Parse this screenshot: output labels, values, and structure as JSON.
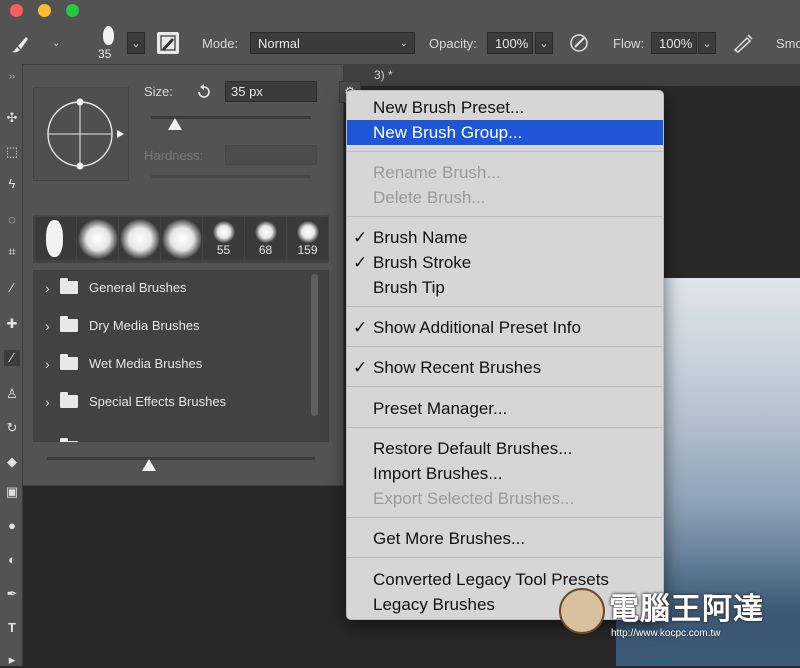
{
  "toolbar": {
    "brush_size": "35",
    "mode_label": "Mode:",
    "mode_value": "Normal",
    "opacity_label": "Opacity:",
    "opacity_value": "100%",
    "flow_label": "Flow:",
    "flow_value": "100%",
    "smoothing_label": "Smo"
  },
  "brush_panel": {
    "size_label": "Size:",
    "size_value": "35 px",
    "hardness_label": "Hardness:",
    "recent_tips": [
      {
        "label": ""
      },
      {
        "label": ""
      },
      {
        "label": ""
      },
      {
        "label": ""
      },
      {
        "label": "55"
      },
      {
        "label": "68"
      },
      {
        "label": "159"
      }
    ],
    "folders": [
      {
        "label": "General Brushes"
      },
      {
        "label": "Dry Media Brushes"
      },
      {
        "label": "Wet Media Brushes"
      },
      {
        "label": "Special Effects Brushes"
      }
    ]
  },
  "document": {
    "tab_fragment": "3) *"
  },
  "menu": {
    "items": [
      {
        "label": "New Brush Preset...",
        "checked": false,
        "disabled": false,
        "highlighted": false
      },
      {
        "label": "New Brush Group...",
        "checked": false,
        "disabled": false,
        "highlighted": true
      },
      {
        "label": "Rename Brush...",
        "checked": false,
        "disabled": true,
        "highlighted": false
      },
      {
        "label": "Delete Brush...",
        "checked": false,
        "disabled": true,
        "highlighted": false
      },
      {
        "label": "Brush Name",
        "checked": true,
        "disabled": false,
        "highlighted": false
      },
      {
        "label": "Brush Stroke",
        "checked": true,
        "disabled": false,
        "highlighted": false
      },
      {
        "label": "Brush Tip",
        "checked": false,
        "disabled": false,
        "highlighted": false
      },
      {
        "label": "Show Additional Preset Info",
        "checked": true,
        "disabled": false,
        "highlighted": false
      },
      {
        "label": "Show Recent Brushes",
        "checked": true,
        "disabled": false,
        "highlighted": false
      },
      {
        "label": "Preset Manager...",
        "checked": false,
        "disabled": false,
        "highlighted": false
      },
      {
        "label": "Restore Default Brushes...",
        "checked": false,
        "disabled": false,
        "highlighted": false
      },
      {
        "label": "Import Brushes...",
        "checked": false,
        "disabled": false,
        "highlighted": false
      },
      {
        "label": "Export Selected Brushes...",
        "checked": false,
        "disabled": true,
        "highlighted": false
      },
      {
        "label": "Get More Brushes...",
        "checked": false,
        "disabled": false,
        "highlighted": false
      },
      {
        "label": "Converted Legacy Tool Presets",
        "checked": false,
        "disabled": false,
        "highlighted": false
      },
      {
        "label": "Legacy Brushes",
        "checked": false,
        "disabled": false,
        "highlighted": false
      }
    ],
    "checkmark_glyph": "✓"
  },
  "watermark": {
    "text": "電腦王阿達",
    "url": "http://www.kocpc.com.tw"
  },
  "colors": {
    "menu_highlight": "#1f56d8",
    "panel_bg": "#535353",
    "app_bg": "#282828"
  }
}
